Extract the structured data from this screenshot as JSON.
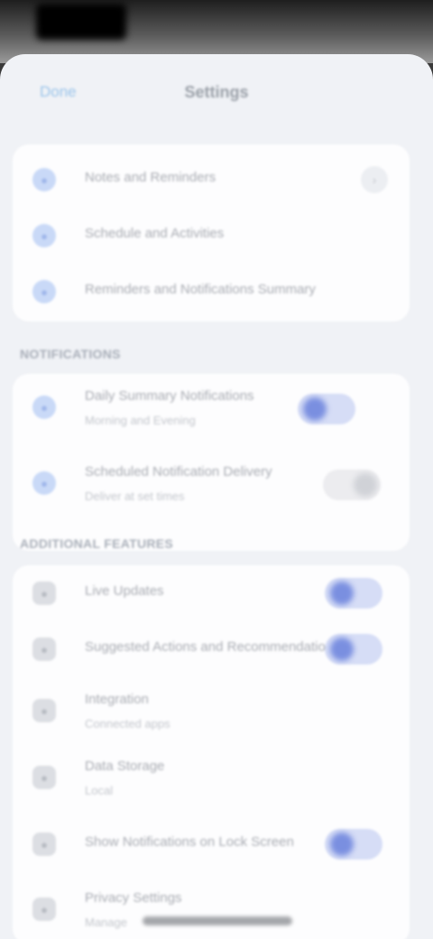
{
  "nav": {
    "back_label": "Done",
    "title": "Settings"
  },
  "top_card": {
    "items": [
      {
        "label": "Notes and Reminders",
        "icon": "bell-icon"
      },
      {
        "label": "Schedule and Activities",
        "icon": "calendar-icon"
      },
      {
        "label": "Reminders and Notifications Summary",
        "icon": "list-icon"
      }
    ]
  },
  "notifications_section": {
    "header": "NOTIFICATIONS",
    "items": [
      {
        "label": "Daily Summary Notifications",
        "sub": "Morning and Evening",
        "toggle": true
      },
      {
        "label": "Scheduled Notification Delivery",
        "sub": "Deliver at set times",
        "toggle": false
      }
    ]
  },
  "features_section": {
    "header": "ADDITIONAL FEATURES",
    "items": [
      {
        "label": "Live Updates",
        "toggle": true
      },
      {
        "label": "Suggested Actions and Recommendations",
        "toggle": true
      },
      {
        "label": "Integration",
        "sub": "Connected apps"
      },
      {
        "label": "Data Storage",
        "sub": "Local"
      },
      {
        "label": "Show Notifications on Lock Screen",
        "toggle": true
      },
      {
        "label": "Privacy Settings",
        "sub": "Manage"
      }
    ]
  }
}
